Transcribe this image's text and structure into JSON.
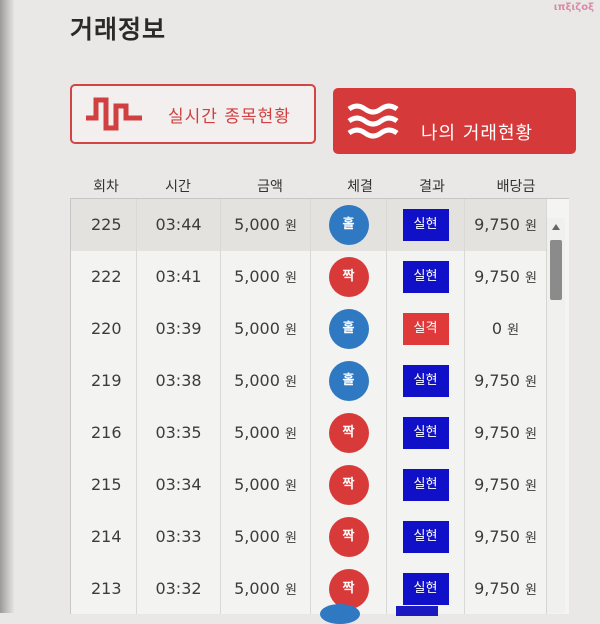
{
  "page": {
    "title": "거래정보",
    "watermark": "ιπξιζοξ"
  },
  "buttons": {
    "realtime": {
      "label": "실시간 종목현황",
      "icon": "pulse-wave-icon",
      "color": "#d24544"
    },
    "my_trades": {
      "label": "나의 거래현황",
      "icon": "waves-icon",
      "color": "#d6393a"
    }
  },
  "table": {
    "headers": [
      "회차",
      "시간",
      "금액",
      "체결",
      "결과",
      "배당금"
    ],
    "rows": [
      {
        "round": "225",
        "time": "03:44",
        "amount": "5,000",
        "bet": "홀",
        "result": "실현",
        "payout": "9,750"
      },
      {
        "round": "222",
        "time": "03:41",
        "amount": "5,000",
        "bet": "짝",
        "result": "실현",
        "payout": "9,750"
      },
      {
        "round": "220",
        "time": "03:39",
        "amount": "5,000",
        "bet": "홀",
        "result": "실격",
        "payout": "0"
      },
      {
        "round": "219",
        "time": "03:38",
        "amount": "5,000",
        "bet": "홀",
        "result": "실현",
        "payout": "9,750"
      },
      {
        "round": "216",
        "time": "03:35",
        "amount": "5,000",
        "bet": "짝",
        "result": "실현",
        "payout": "9,750"
      },
      {
        "round": "215",
        "time": "03:34",
        "amount": "5,000",
        "bet": "짝",
        "result": "실현",
        "payout": "9,750"
      },
      {
        "round": "214",
        "time": "03:33",
        "amount": "5,000",
        "bet": "짝",
        "result": "실현",
        "payout": "9,750"
      },
      {
        "round": "213",
        "time": "03:32",
        "amount": "5,000",
        "bet": "짝",
        "result": "실현",
        "payout": "9,750"
      }
    ],
    "currency": "원"
  },
  "colors": {
    "odd": "#2f78c2",
    "even": "#d83a3a",
    "win": "#1010c8",
    "lose": "#e0393a"
  }
}
